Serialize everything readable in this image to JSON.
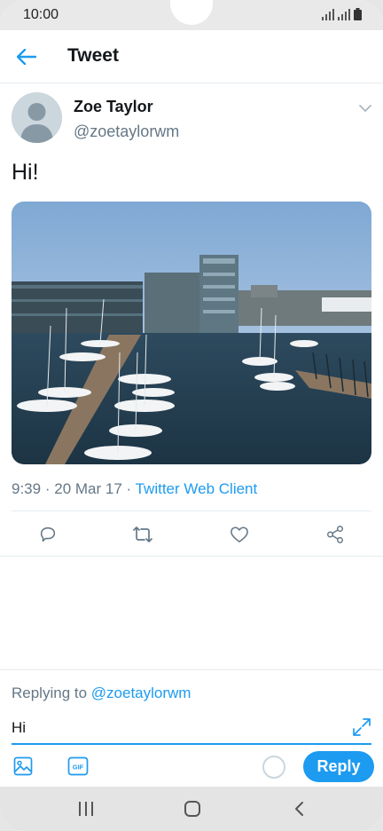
{
  "status_bar": {
    "time": "10:00",
    "icons": [
      "signal-icon",
      "signal-icon-2",
      "battery-icon"
    ]
  },
  "header": {
    "back_icon": "arrow-left-icon",
    "title": "Tweet"
  },
  "tweet": {
    "author_name": "Zoe Taylor",
    "author_handle": "@zoetaylorwm",
    "text": "Hi!",
    "media_description_icon": "photo",
    "time": "9:39",
    "separator": "·",
    "date": "20 Mar 17",
    "client": "Twitter Web Client"
  },
  "actions": [
    {
      "name": "reply-action",
      "icon": "comment-icon"
    },
    {
      "name": "retweet-action",
      "icon": "retweet-icon"
    },
    {
      "name": "like-action",
      "icon": "heart-icon"
    },
    {
      "name": "share-action",
      "icon": "share-icon"
    }
  ],
  "reply": {
    "replying_prefix": "Replying to",
    "replying_handle": "@zoetaylorwm",
    "input_value": "Hi",
    "button_label": "Reply"
  },
  "colors": {
    "accent": "#1d9bf0",
    "secondary_text": "#657786",
    "divider": "#e6ecf0"
  }
}
